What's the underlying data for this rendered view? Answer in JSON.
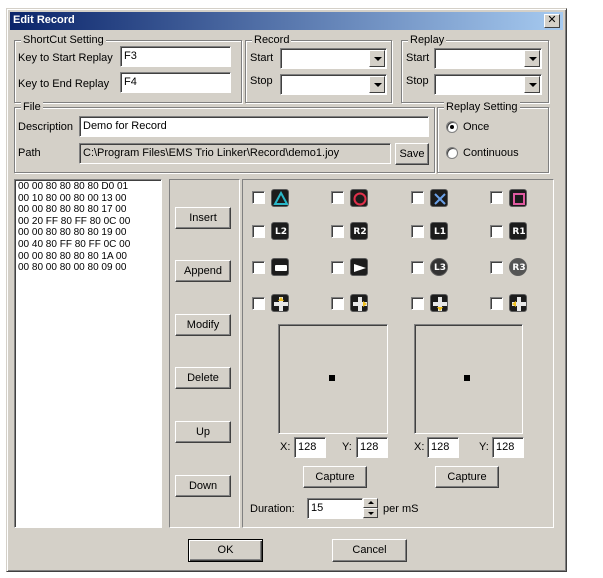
{
  "window": {
    "title": "Edit Record",
    "close_glyph": "✕"
  },
  "shortcut": {
    "legend": "ShortCut Setting",
    "start_label": "Key to Start Replay",
    "start_value": "F3",
    "end_label": "Key to End Replay",
    "end_value": "F4"
  },
  "record": {
    "legend": "Record",
    "start_label": "Start",
    "stop_label": "Stop",
    "start_value": "",
    "stop_value": ""
  },
  "replay": {
    "legend": "Replay",
    "start_label": "Start",
    "stop_label": "Stop",
    "start_value": "",
    "stop_value": ""
  },
  "file": {
    "legend": "File",
    "description_label": "Description",
    "description_value": "Demo for Record",
    "path_label": "Path",
    "path_value": "C:\\Program Files\\EMS Trio Linker\\Record\\demo1.joy",
    "save_label": "Save"
  },
  "replay_setting": {
    "legend": "Replay Setting",
    "once_label": "Once",
    "continuous_label": "Continuous",
    "selected": "Once"
  },
  "data_list": [
    "00 00 80 80 80 80 D0 01",
    "00 10 80 00 80 00 13 00",
    "00 00 80 80 80 80 17 00",
    "00 20 FF 80 FF 80 0C 00",
    "00 00 80 80 80 80 19 00",
    "00 40 80 FF 80 FF 0C 00",
    "00 00 80 80 80 80 1A 00",
    "00 80 00 80 00 80 09 00"
  ],
  "actions": {
    "insert": "Insert",
    "append": "Append",
    "modify": "Modify",
    "delete": "Delete",
    "up": "Up",
    "down": "Down"
  },
  "pad_buttons": {
    "l2": "L2",
    "r2": "R2",
    "l1": "L1",
    "r1": "R1",
    "l3": "L3",
    "r3": "R3"
  },
  "left_stick": {
    "x_label": "X:",
    "x_value": "128",
    "y_label": "Y:",
    "y_value": "128",
    "capture_label": "Capture"
  },
  "right_stick": {
    "x_label": "X:",
    "x_value": "128",
    "y_label": "Y:",
    "y_value": "128",
    "capture_label": "Capture"
  },
  "duration": {
    "label": "Duration:",
    "value": "15",
    "unit": "per mS"
  },
  "footer": {
    "ok_label": "OK",
    "cancel_label": "Cancel"
  },
  "colors": {
    "title_start": "#0a246a",
    "title_end": "#a6caf0",
    "face": "#d4d0c8",
    "triangle": "#2ab7c8",
    "circle": "#e0304a",
    "cross": "#6aa0e8",
    "square": "#e05aa0"
  }
}
